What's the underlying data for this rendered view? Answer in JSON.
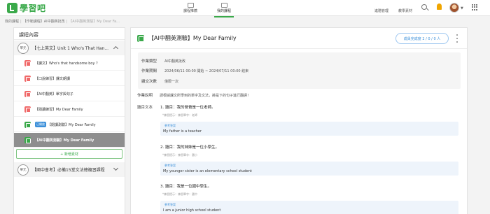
{
  "app": {
    "logo_text": "學習吧"
  },
  "nav": {
    "course_home": "課程推薦",
    "my_courses": "我的課程",
    "progress": "進階管理",
    "materials": "教學素材"
  },
  "breadcrumb": {
    "item1": "我的課程",
    "item2": "【作範課程】AI中翻英批改",
    "item3": "【AI中翻英測驗】My Dear Fa..."
  },
  "sidebar": {
    "title": "課程內容",
    "unit1": {
      "badge": "單元",
      "title": "【七上英文】Unit 1 Who's That Han..."
    },
    "items": [
      {
        "label": "【課文】Who's that handsome boy ?",
        "color": "#f06a6a"
      },
      {
        "label": "【口說練習】課文朗讀",
        "color": "#f06a6a"
      },
      {
        "label": "【AI中翻英】單字與句子",
        "color": "#f06a6a"
      },
      {
        "label": "【閱讀練習】My Dear Family",
        "color": "#f06a6a"
      },
      {
        "tag": "已開放",
        "label": "【閱讀測驗】My Dear Family",
        "color": "#3aa94a"
      },
      {
        "label": "【AI中翻英測驗】My Dear Family",
        "color": "#3aa94a"
      }
    ],
    "add_label": "+ 新增素材",
    "unit2": {
      "badge": "單元",
      "title": "【國中會考】必備15堂文法總複習課程"
    }
  },
  "main": {
    "title": "【AI中翻英測驗】My Dear Family",
    "completion": "成員完成度 2 / 0 / 0 人",
    "info": {
      "type_key": "作業類型",
      "type_val": "AI中翻英批改",
      "period_key": "作業期間",
      "period_val": "2024/06/11 00:00 開始 ~ 2024/07/11 00:00 結束",
      "submit_key": "繳交次數",
      "submit_val": "僅限一次"
    },
    "desc_key": "作業說明",
    "desc_val": "請根據課文所學到的單字及文法，將是下的句子進行翻譯！",
    "questions_key": "題目文本",
    "questions": [
      {
        "title": "1. 題目：我的爸爸是一位老師。",
        "hint": "*練習提示：練習單字：老師",
        "ans_label": "參考答案",
        "answer": "My father is a teacher"
      },
      {
        "title": "2. 題目：我的妹妹是一位小學生。",
        "hint": "*練習提示：練習單字：國小",
        "ans_label": "參考答案",
        "answer": "My younger sister is an elementary school student"
      },
      {
        "title": "3. 題目：我是一位國中學生。",
        "hint": "*練習提示：練習單字：國中",
        "ans_label": "參考答案",
        "answer": "I am a junior high school student"
      }
    ]
  }
}
